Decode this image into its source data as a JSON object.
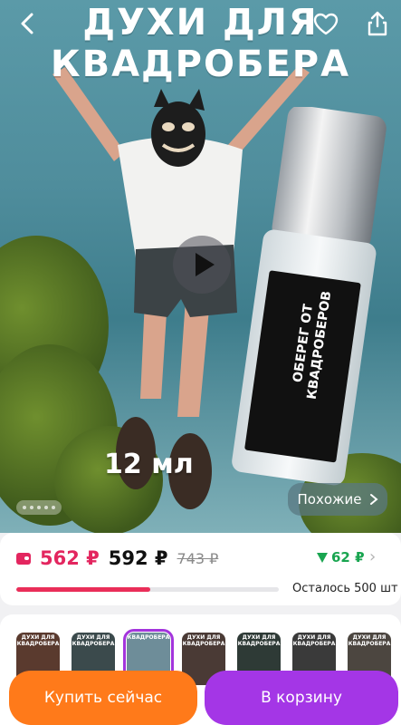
{
  "hero": {
    "headline_line1": "ДУХИ ДЛЯ",
    "headline_line2": "КВАДРОБЕРА",
    "volume_label": "12 мл",
    "bottle_label_line1": "ОБЕРЕГ ОТ",
    "bottle_label_line2": "КВАДРОБЕРОВ",
    "similar_button": "Похожие",
    "icons": {
      "back": "back-arrow-icon",
      "favorite": "heart-icon",
      "share": "share-icon",
      "play": "play-icon"
    }
  },
  "pricing": {
    "card_price": "562 ₽",
    "price": "592 ₽",
    "old_price": "743 ₽",
    "cashback": "62 ₽",
    "stock_text": "Осталось 500 шт",
    "stock_progress_percent": 51,
    "colors": {
      "accent": "#e3265f",
      "cashback": "#19a550"
    }
  },
  "thumbnails": [
    {
      "label": "ДУХИ ДЛЯ КВАДРОБЕРА",
      "selected": false
    },
    {
      "label": "ДУХИ ДЛЯ КВАДРОБЕРА",
      "selected": false
    },
    {
      "label": "КВАДРОБЕРА",
      "selected": true
    },
    {
      "label": "ДУХИ ДЛЯ КВАДРОБЕРА",
      "selected": false
    },
    {
      "label": "ДУХИ ДЛЯ КВАДРОБЕРА",
      "selected": false
    },
    {
      "label": "ДУХИ ДЛЯ КВАДРОБЕРА",
      "selected": false
    },
    {
      "label": "ДУХИ ДЛЯ КВАДРОБЕРА",
      "selected": false
    }
  ],
  "actions": {
    "buy_now": "Купить сейчас",
    "add_to_cart": "В корзину",
    "colors": {
      "buy": "#ff7a1a",
      "cart": "#a436e6"
    }
  }
}
